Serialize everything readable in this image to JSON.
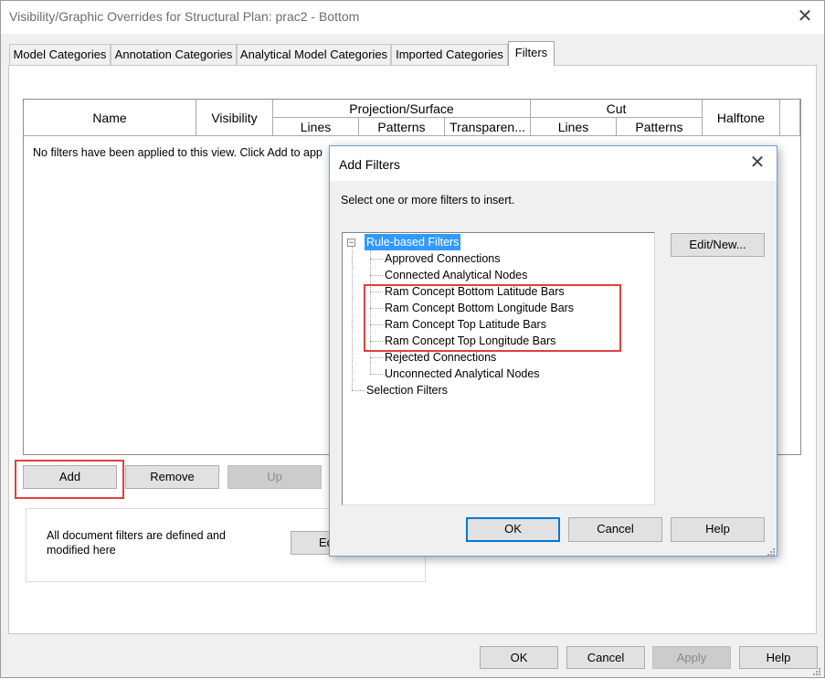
{
  "window": {
    "title": "Visibility/Graphic Overrides for Structural Plan: prac2 - Bottom",
    "close_glyph": "✕"
  },
  "tabs": [
    {
      "label": "Model Categories",
      "active": false
    },
    {
      "label": "Annotation Categories",
      "active": false
    },
    {
      "label": "Analytical Model Categories",
      "active": false
    },
    {
      "label": "Imported Categories",
      "active": false
    },
    {
      "label": "Filters",
      "active": true
    }
  ],
  "filters_grid": {
    "columns": {
      "name": "Name",
      "visibility": "Visibility",
      "projection_surface": "Projection/Surface",
      "proj_lines": "Lines",
      "proj_patterns": "Patterns",
      "proj_transparency": "Transparen...",
      "cut": "Cut",
      "cut_lines": "Lines",
      "cut_patterns": "Patterns",
      "halftone": "Halftone"
    },
    "empty_message": "No filters have been applied to this view. Click Add to app"
  },
  "grid_buttons": {
    "add": "Add",
    "remove": "Remove",
    "up": "Up"
  },
  "doc_filters": {
    "text": "All document filters are defined and\nmodified here",
    "edit_button": "Ed"
  },
  "footer_buttons": {
    "ok": "OK",
    "cancel": "Cancel",
    "apply": "Apply",
    "help": "Help"
  },
  "add_filters_dialog": {
    "title": "Add Filters",
    "close_glyph": "✕",
    "instruction": "Select one or more filters to insert.",
    "edit_new_button": "Edit/New...",
    "tree": {
      "expander_glyph": "−",
      "root_rule_based": "Rule-based Filters",
      "rule_based_children": [
        "Approved Connections",
        "Connected Analytical Nodes",
        "Ram Concept Bottom Latitude Bars",
        "Ram Concept Bottom Longitude Bars",
        "Ram Concept Top Latitude Bars",
        "Ram Concept Top Longitude Bars",
        "Rejected Connections",
        "Unconnected Analytical Nodes"
      ],
      "root_selection": "Selection Filters"
    },
    "buttons": {
      "ok": "OK",
      "cancel": "Cancel",
      "help": "Help"
    }
  },
  "colors": {
    "highlight_box": "#e0403f",
    "selection": "#3399ff",
    "focus_border": "#0078d7",
    "dialog_border": "#6b9ed6"
  }
}
